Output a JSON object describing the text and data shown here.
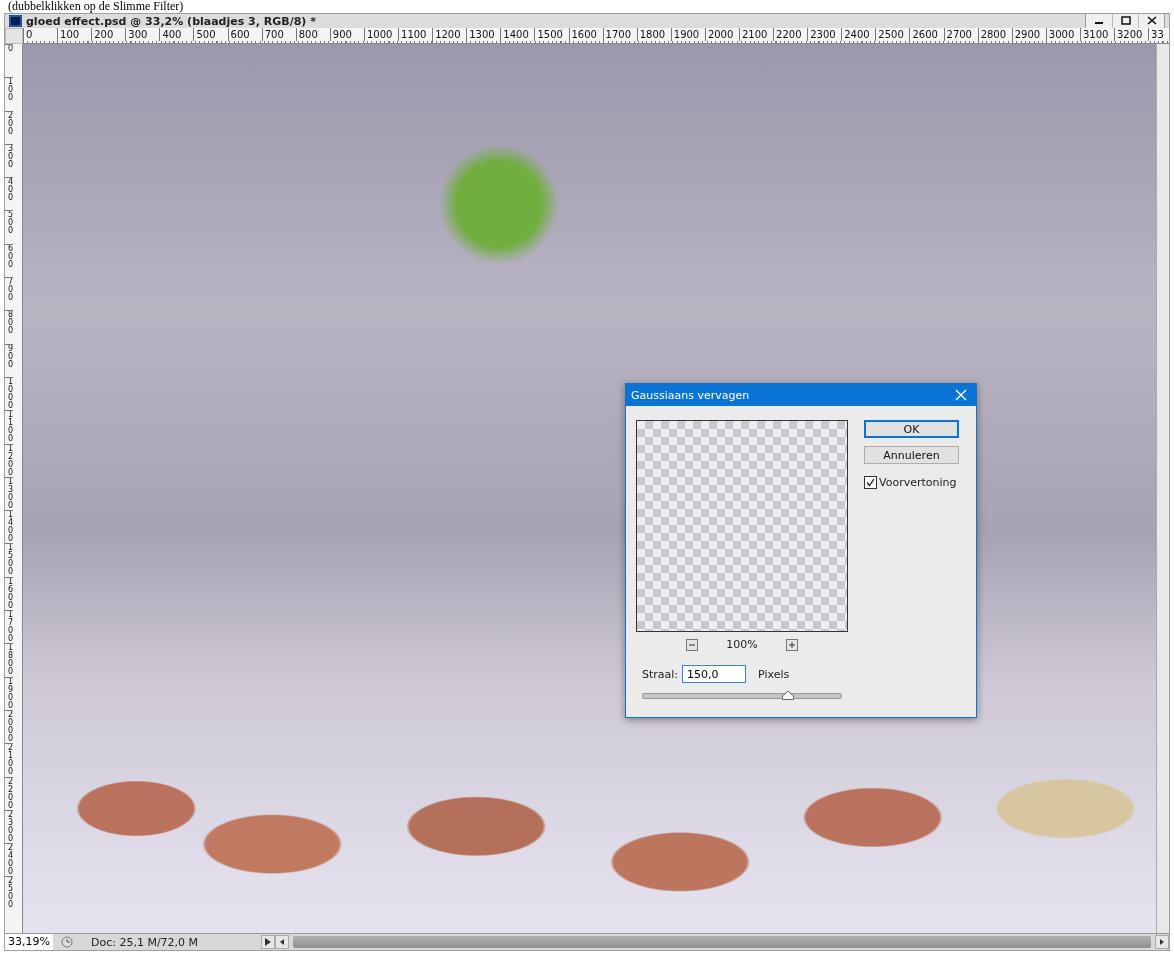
{
  "caption": "(dubbelklikken op de Slimme Filter)",
  "document": {
    "title": "gloed effect.psd @ 33,2% (blaadjes 3, RGB/8) *"
  },
  "rulers": {
    "horizontal": [
      "0",
      "100",
      "200",
      "300",
      "400",
      "500",
      "600",
      "700",
      "800",
      "900",
      "1000",
      "1100",
      "1200",
      "1300",
      "1400",
      "1500",
      "1600",
      "1700",
      "1800",
      "1900",
      "2000",
      "2100",
      "2200",
      "2300",
      "2400",
      "2500",
      "2600",
      "2700",
      "2800",
      "2900",
      "3000",
      "3100",
      "3200",
      "33"
    ],
    "vertical": [
      "0",
      "100",
      "200",
      "300",
      "400",
      "500",
      "600",
      "700",
      "800",
      "900",
      "1000",
      "1100",
      "1200",
      "1300",
      "1400",
      "1500",
      "1600",
      "1700",
      "1800",
      "1900",
      "2000",
      "2100",
      "2200",
      "2300",
      "2400",
      "2500"
    ]
  },
  "dialog": {
    "title": "Gaussiaans vervagen",
    "buttons": [
      {
        "label": "OK",
        "selected": true
      },
      {
        "label": "Annuleren",
        "selected": false
      }
    ],
    "preview": {
      "label": "Voorvertoning",
      "checked": true
    },
    "zoom": "100%",
    "radius": {
      "label": "Straal:",
      "value": "150,0",
      "unit": "Pixels",
      "level": 0.73
    }
  },
  "status_bar": {
    "zoom": "33,19%",
    "doc": "Doc: 25,1 M/72,0 M"
  }
}
